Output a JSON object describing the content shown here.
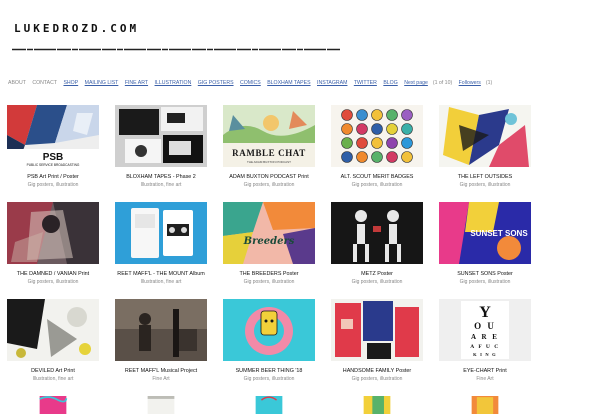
{
  "site": {
    "logo_text": "LUKEDROZD.COM"
  },
  "nav": {
    "items": [
      "ABOUT",
      "CONTACT",
      "SHOP",
      "MAILING LIST",
      "FINE ART",
      "ILLUSTRATION",
      "GIG POSTERS",
      "COMICS",
      "BLOXHAM TAPES",
      "INSTAGRAM",
      "TWITTER",
      "BLOG"
    ],
    "next_page": "Next page",
    "page_info": "(1 of 10)",
    "followers": "Followers",
    "followers_count": "(1)"
  },
  "works": [
    {
      "title": "PSB Art Print / Poster",
      "tags": "Gig posters, illustration",
      "thumb_text": "PSB",
      "thumb_sub": "PUBLIC SERVICE BROADCASTING"
    },
    {
      "title": "BLOXHAM TAPES - Phase 2",
      "tags": "Illustration, fine art",
      "thumb_text": "",
      "thumb_sub": ""
    },
    {
      "title": "ADAM BUXTON PODCAST Print",
      "tags": "Gig posters, illustration",
      "thumb_text": "RAMBLE CHAT",
      "thumb_sub": "THE ADAM BUXTON PODCAST"
    },
    {
      "title": "ALT. SCOUT MERIT BADGES",
      "tags": "Gig posters, illustration",
      "thumb_text": "",
      "thumb_sub": ""
    },
    {
      "title": "THE LEFT OUTSIDES",
      "tags": "Gig posters, illustration",
      "thumb_text": "",
      "thumb_sub": ""
    },
    {
      "title": "THE DAMNED / VANIAN Print",
      "tags": "Gig posters, illustration",
      "thumb_text": "",
      "thumb_sub": ""
    },
    {
      "title": "REET MAFF'L - THE MOUNT Album",
      "tags": "Illustration, fine art",
      "thumb_text": "",
      "thumb_sub": ""
    },
    {
      "title": "THE BREEDERS Poster",
      "tags": "Gig posters, illustration",
      "thumb_text": "Breeders",
      "thumb_sub": ""
    },
    {
      "title": "METZ Poster",
      "tags": "Gig posters, illustration",
      "thumb_text": "",
      "thumb_sub": ""
    },
    {
      "title": "SUNSET SONS Poster",
      "tags": "Gig posters, illustration",
      "thumb_text": "SUNSET SONS",
      "thumb_sub": ""
    },
    {
      "title": "DEVILED Art Print",
      "tags": "Illustration, fine art",
      "thumb_text": "",
      "thumb_sub": ""
    },
    {
      "title": "REET MAFF'L Musical Project",
      "tags": "Fine Art",
      "thumb_text": "",
      "thumb_sub": ""
    },
    {
      "title": "SUMMER BEER THING '18",
      "tags": "Gig posters, illustration",
      "thumb_text": "",
      "thumb_sub": ""
    },
    {
      "title": "HANDSOME FAMILY Poster",
      "tags": "Gig posters, illustration",
      "thumb_text": "",
      "thumb_sub": ""
    },
    {
      "title": "EYE-CHART Print",
      "tags": "Fine Art",
      "thumb_text": "YOU ARE A FUC KING",
      "thumb_sub": ""
    }
  ]
}
